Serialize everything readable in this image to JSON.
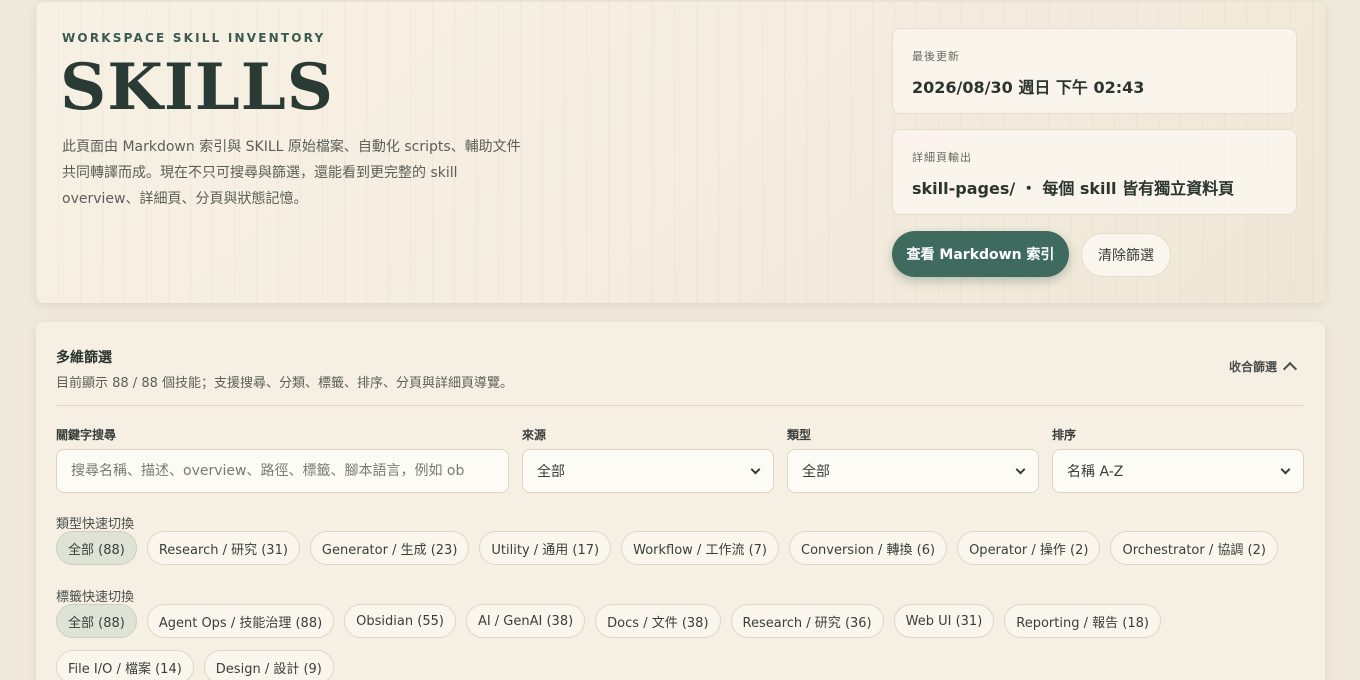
{
  "hero": {
    "eyebrow": "WORKSPACE SKILL INVENTORY",
    "title": "SKILLS",
    "description_lines": [
      "此頁面由 Markdown 索引與 SKILL 原始檔案、自動化 scripts、輔助文件",
      "共同轉譯而成。現在不只可搜尋與篩選，還能看到更完整的 skill",
      "overview、詳細頁、分頁與狀態記憶。"
    ],
    "last_updated_label": "最後更新",
    "last_updated_value": "2026/08/30 週日 下午 02:43",
    "detail_output_label": "詳細頁輸出",
    "detail_output_value": "skill-pages/ ・ 每個 skill 皆有獨立資料頁",
    "primary_button": "查看 Markdown 索引",
    "secondary_button": "清除篩選"
  },
  "filters": {
    "title": "多維篩選",
    "subtitle": "目前顯示 88 / 88 個技能；支援搜尋、分類、標籤、排序、分頁與詳細頁導覽。",
    "collapse_label": "收合篩選",
    "keyword_label": "關鍵字搜尋",
    "keyword_placeholder": "搜尋名稱、描述、overview、路徑、標籤、腳本語言，例如 ob",
    "source_label": "來源",
    "source_value": "全部",
    "type_label": "類型",
    "type_value": "全部",
    "sort_label": "排序",
    "sort_value": "名稱 A-Z",
    "type_quick_label": "類型快速切換",
    "type_chips": [
      "全部 (88)",
      "Research / 研究 (31)",
      "Generator / 生成 (23)",
      "Utility / 通用 (17)",
      "Workflow / 工作流 (7)",
      "Conversion / 轉換 (6)",
      "Operator / 操作 (2)",
      "Orchestrator / 協調 (2)"
    ],
    "tag_quick_label": "標籤快速切換",
    "tag_chips": [
      "全部 (88)",
      "Agent Ops / 技能治理 (88)",
      "Obsidian (55)",
      "AI / GenAI (38)",
      "Docs / 文件 (38)",
      "Research / 研究 (36)",
      "Web UI (31)",
      "Reporting / 報告 (18)",
      "File I/O / 檔案 (14)",
      "Design / 設計 (9)"
    ]
  },
  "colors": {
    "accent": "#3e6b5e",
    "background": "#efe9dc",
    "chip_active": "#dfe3d6"
  }
}
